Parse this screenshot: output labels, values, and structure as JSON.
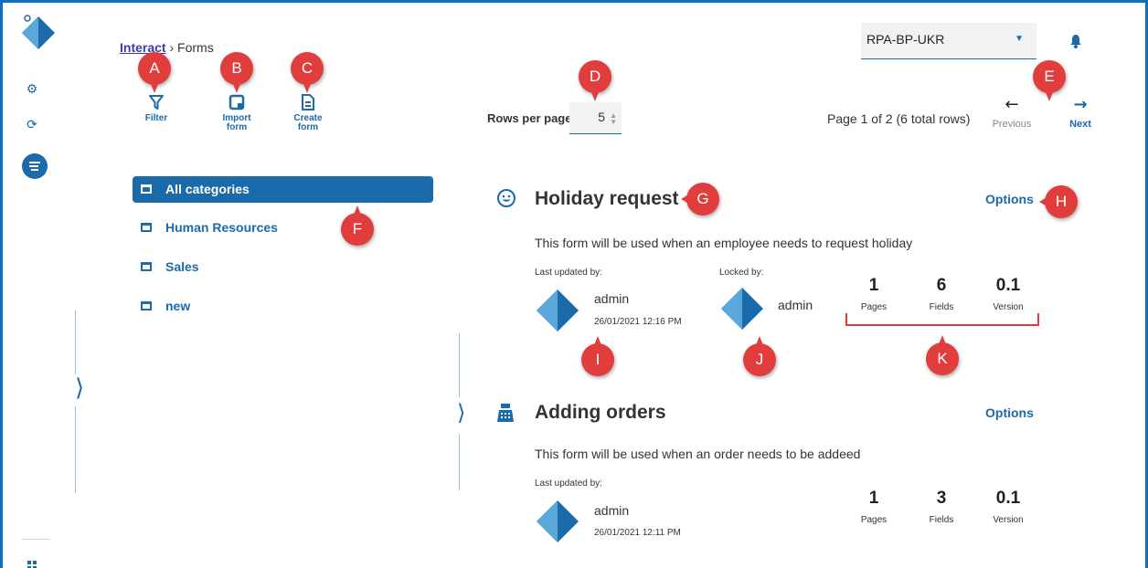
{
  "breadcrumb": {
    "root": "Interact",
    "separator": "›",
    "current": "Forms"
  },
  "toolbar": {
    "filter": "Filter",
    "import_line1": "Import",
    "import_line2": "form",
    "create_line1": "Create",
    "create_line2": "form"
  },
  "pagination": {
    "rows_label": "Rows per page",
    "rows_value": "5",
    "page_info": "Page 1 of 2 (6 total rows)",
    "previous": "Previous",
    "next": "Next"
  },
  "environment": {
    "selected": "RPA-BP-UKR"
  },
  "categories": [
    {
      "label": "All categories",
      "active": true
    },
    {
      "label": "Human Resources",
      "active": false
    },
    {
      "label": "Sales",
      "active": false
    },
    {
      "label": "new",
      "active": false
    }
  ],
  "forms": [
    {
      "title": "Holiday request",
      "icon": "smiley-icon",
      "options": "Options",
      "description": "This form will be used when an employee needs to request holiday",
      "last_updated_label": "Last updated by:",
      "last_updated_user": "admin",
      "last_updated_date": "26/01/2021 12:16 PM",
      "locked_label": "Locked by:",
      "locked_user": "admin",
      "pages": "1",
      "pages_label": "Pages",
      "fields": "6",
      "fields_label": "Fields",
      "version": "0.1",
      "version_label": "Version"
    },
    {
      "title": "Adding orders",
      "icon": "cash-register-icon",
      "options": "Options",
      "description": "This form will be used when an order needs to be addeed",
      "last_updated_label": "Last updated by:",
      "last_updated_user": "admin",
      "last_updated_date": "26/01/2021 12:11 PM",
      "pages": "1",
      "pages_label": "Pages",
      "fields": "3",
      "fields_label": "Fields",
      "version": "0.1",
      "version_label": "Version"
    }
  ],
  "markers": [
    "A",
    "B",
    "C",
    "D",
    "E",
    "F",
    "G",
    "H",
    "I",
    "J",
    "K"
  ],
  "colors": {
    "accent": "#1b6aa9",
    "marker": "#e23d3d",
    "link": "#3d3bb3"
  }
}
